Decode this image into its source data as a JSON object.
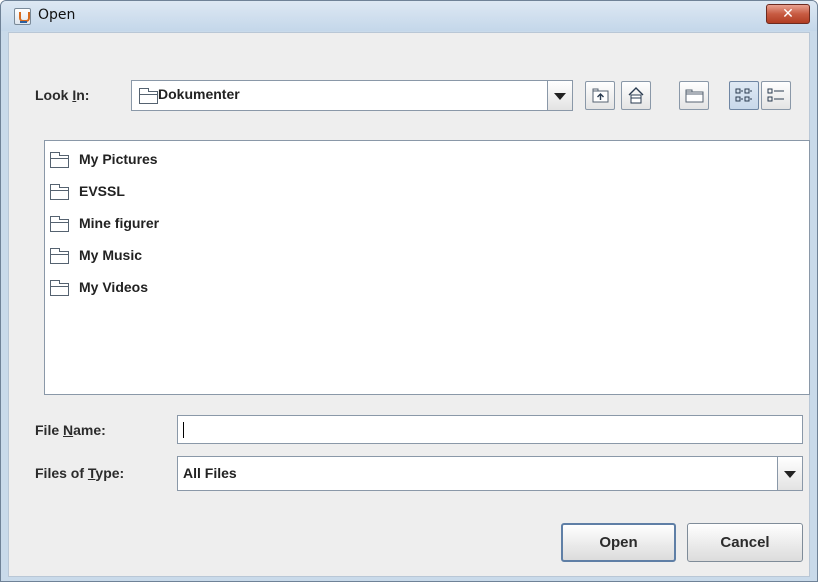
{
  "window": {
    "title": "Open",
    "close_glyph": "✕",
    "app_icon": "java-cup-icon"
  },
  "look_in": {
    "label_pre": "Look ",
    "label_mnemonic": "I",
    "label_post": "n:",
    "value": "Dokumenter",
    "icon": "folder-icon"
  },
  "toolbar": {
    "up_one_level": "folder-up-icon",
    "home": "home-icon",
    "new_folder": "new-folder-icon",
    "list_view": "list-view-icon",
    "details_view": "details-view-icon",
    "selected_view": "list"
  },
  "files": [
    {
      "name": "My Pictures",
      "icon": "folder-icon"
    },
    {
      "name": "EVSSL",
      "icon": "folder-icon"
    },
    {
      "name": "Mine figurer",
      "icon": "folder-icon"
    },
    {
      "name": "My Music",
      "icon": "folder-icon"
    },
    {
      "name": "My Videos",
      "icon": "folder-icon"
    }
  ],
  "file_name": {
    "label_pre": "File ",
    "label_mnemonic": "N",
    "label_post": "ame:",
    "value": ""
  },
  "files_of_type": {
    "label_pre": "Files of ",
    "label_mnemonic": "T",
    "label_post": "ype:",
    "value": "All Files"
  },
  "buttons": {
    "open": "Open",
    "cancel": "Cancel"
  },
  "colors": {
    "title_bar": "#c4d7ea",
    "close_button": "#c75b42",
    "panel": "#eeeeee",
    "selected_toggle": "#c8d8ea"
  }
}
